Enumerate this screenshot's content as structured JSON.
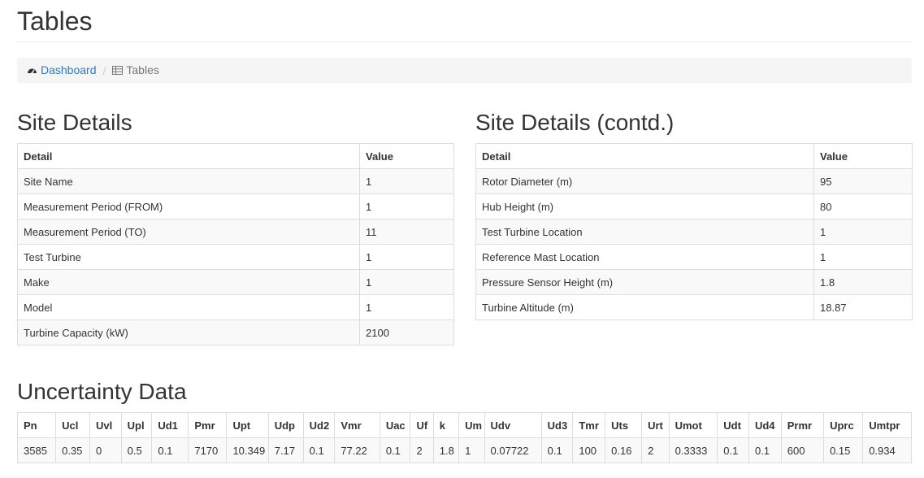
{
  "page": {
    "title": "Tables"
  },
  "breadcrumb": {
    "home": "Dashboard",
    "current": "Tables"
  },
  "site_details": {
    "title": "Site Details",
    "headers": [
      "Detail",
      "Value"
    ],
    "rows": [
      [
        "Site Name",
        "1"
      ],
      [
        "Measurement Period (FROM)",
        "1"
      ],
      [
        "Measurement Period (TO)",
        "11"
      ],
      [
        "Test Turbine",
        "1"
      ],
      [
        "Make",
        "1"
      ],
      [
        "Model",
        "1"
      ],
      [
        "Turbine Capacity (kW)",
        "2100"
      ]
    ]
  },
  "site_details_contd": {
    "title": "Site Details (contd.)",
    "headers": [
      "Detail",
      "Value"
    ],
    "rows": [
      [
        "Rotor Diameter (m)",
        "95"
      ],
      [
        "Hub Height (m)",
        "80"
      ],
      [
        "Test Turbine Location",
        "1"
      ],
      [
        "Reference Mast Location",
        "1"
      ],
      [
        "Pressure Sensor Height (m)",
        "1.8"
      ],
      [
        "Turbine Altitude (m)",
        "18.87"
      ]
    ]
  },
  "uncertainty": {
    "title": "Uncertainty Data",
    "headers": [
      "Pn",
      "Ucl",
      "Uvl",
      "Upl",
      "Ud1",
      "Pmr",
      "Upt",
      "Udp",
      "Ud2",
      "Vmr",
      "Uac",
      "Uf",
      "k",
      "Um",
      "Udv",
      "Ud3",
      "Tmr",
      "Uts",
      "Urt",
      "Umot",
      "Udt",
      "Ud4",
      "Prmr",
      "Uprc",
      "Umtpr"
    ],
    "values": [
      "3585",
      "0.35",
      "0",
      "0.5",
      "0.1",
      "7170",
      "10.349",
      "7.17",
      "0.1",
      "77.22",
      "0.1",
      "2",
      "1.8",
      "1",
      "0.07722",
      "0.1",
      "100",
      "0.16",
      "2",
      "0.3333",
      "0.1",
      "0.1",
      "600",
      "0.15",
      "0.934"
    ]
  }
}
